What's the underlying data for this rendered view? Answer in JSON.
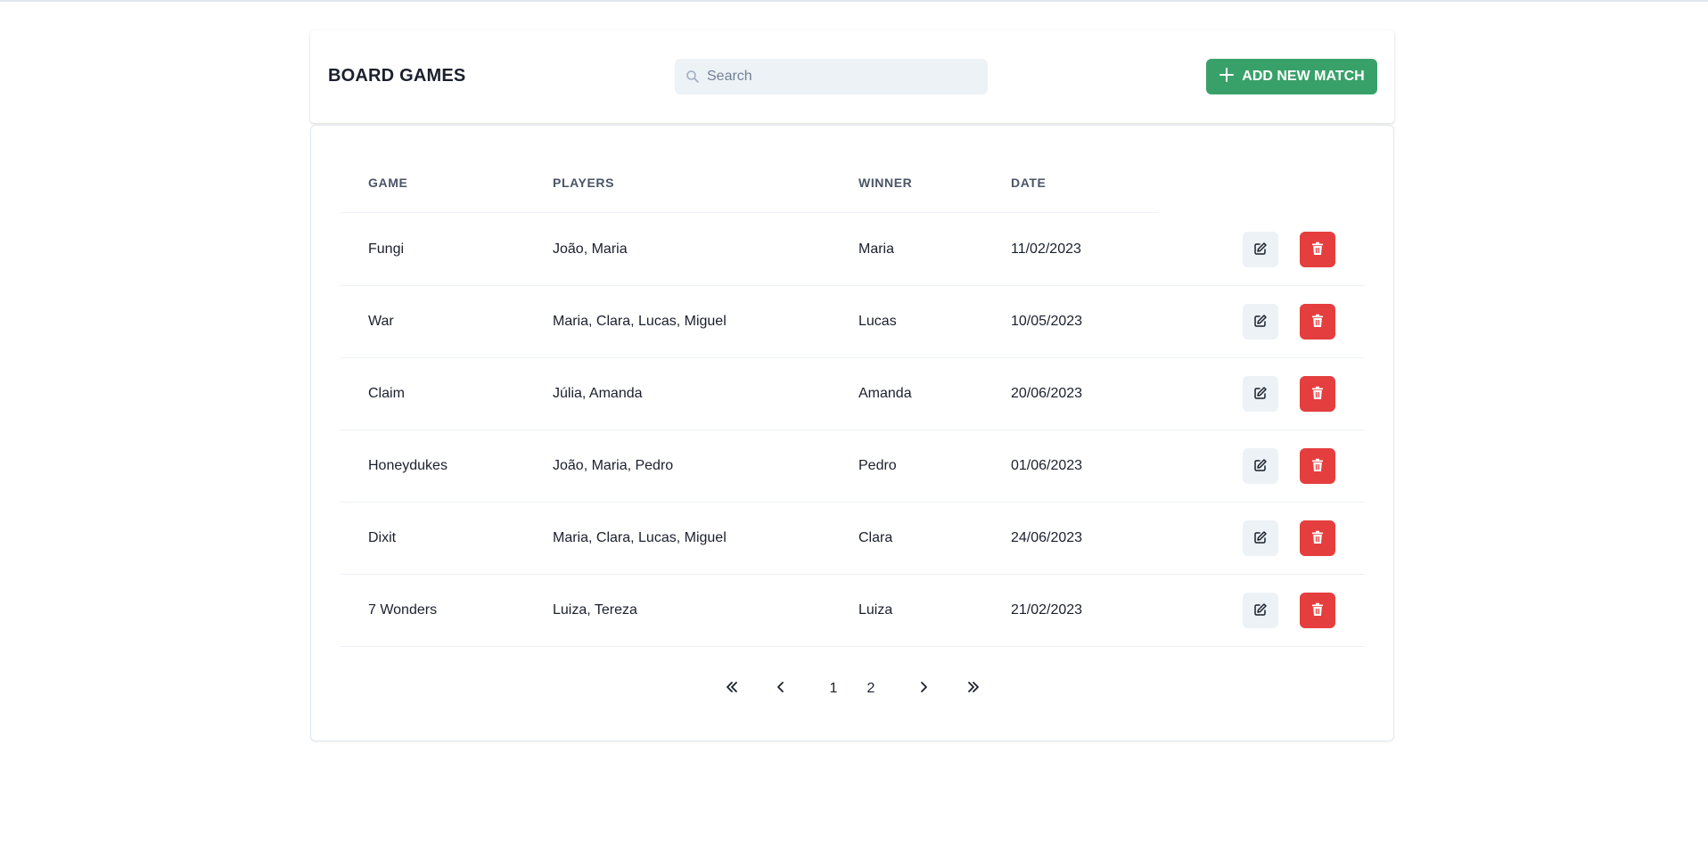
{
  "header": {
    "title": "BOARD GAMES",
    "search_placeholder": "Search",
    "add_button_label": "ADD NEW MATCH"
  },
  "table": {
    "columns": [
      "GAME",
      "PLAYERS",
      "WINNER",
      "DATE"
    ],
    "rows": [
      {
        "game": "Fungi",
        "players": "João, Maria",
        "winner": "Maria",
        "date": "11/02/2023"
      },
      {
        "game": "War",
        "players": "Maria, Clara, Lucas, Miguel",
        "winner": "Lucas",
        "date": "10/05/2023"
      },
      {
        "game": "Claim",
        "players": "Júlia, Amanda",
        "winner": "Amanda",
        "date": "20/06/2023"
      },
      {
        "game": "Honeydukes",
        "players": "João, Maria, Pedro",
        "winner": "Pedro",
        "date": "01/06/2023"
      },
      {
        "game": "Dixit",
        "players": "Maria, Clara, Lucas, Miguel",
        "winner": "Clara",
        "date": "24/06/2023"
      },
      {
        "game": "7 Wonders",
        "players": "Luiza, Tereza",
        "winner": "Luiza",
        "date": "21/02/2023"
      }
    ],
    "row_actions": {
      "edit_icon": "edit-icon",
      "delete_icon": "trash-icon"
    }
  },
  "pagination": {
    "pages": [
      "1",
      "2"
    ],
    "icons": [
      "double-chevron-left-icon",
      "chevron-left-icon",
      "chevron-right-icon",
      "double-chevron-right-icon"
    ]
  },
  "colors": {
    "primary_green": "#38a169",
    "danger_red": "#e53e3e",
    "light_gray": "#edf2f7"
  }
}
